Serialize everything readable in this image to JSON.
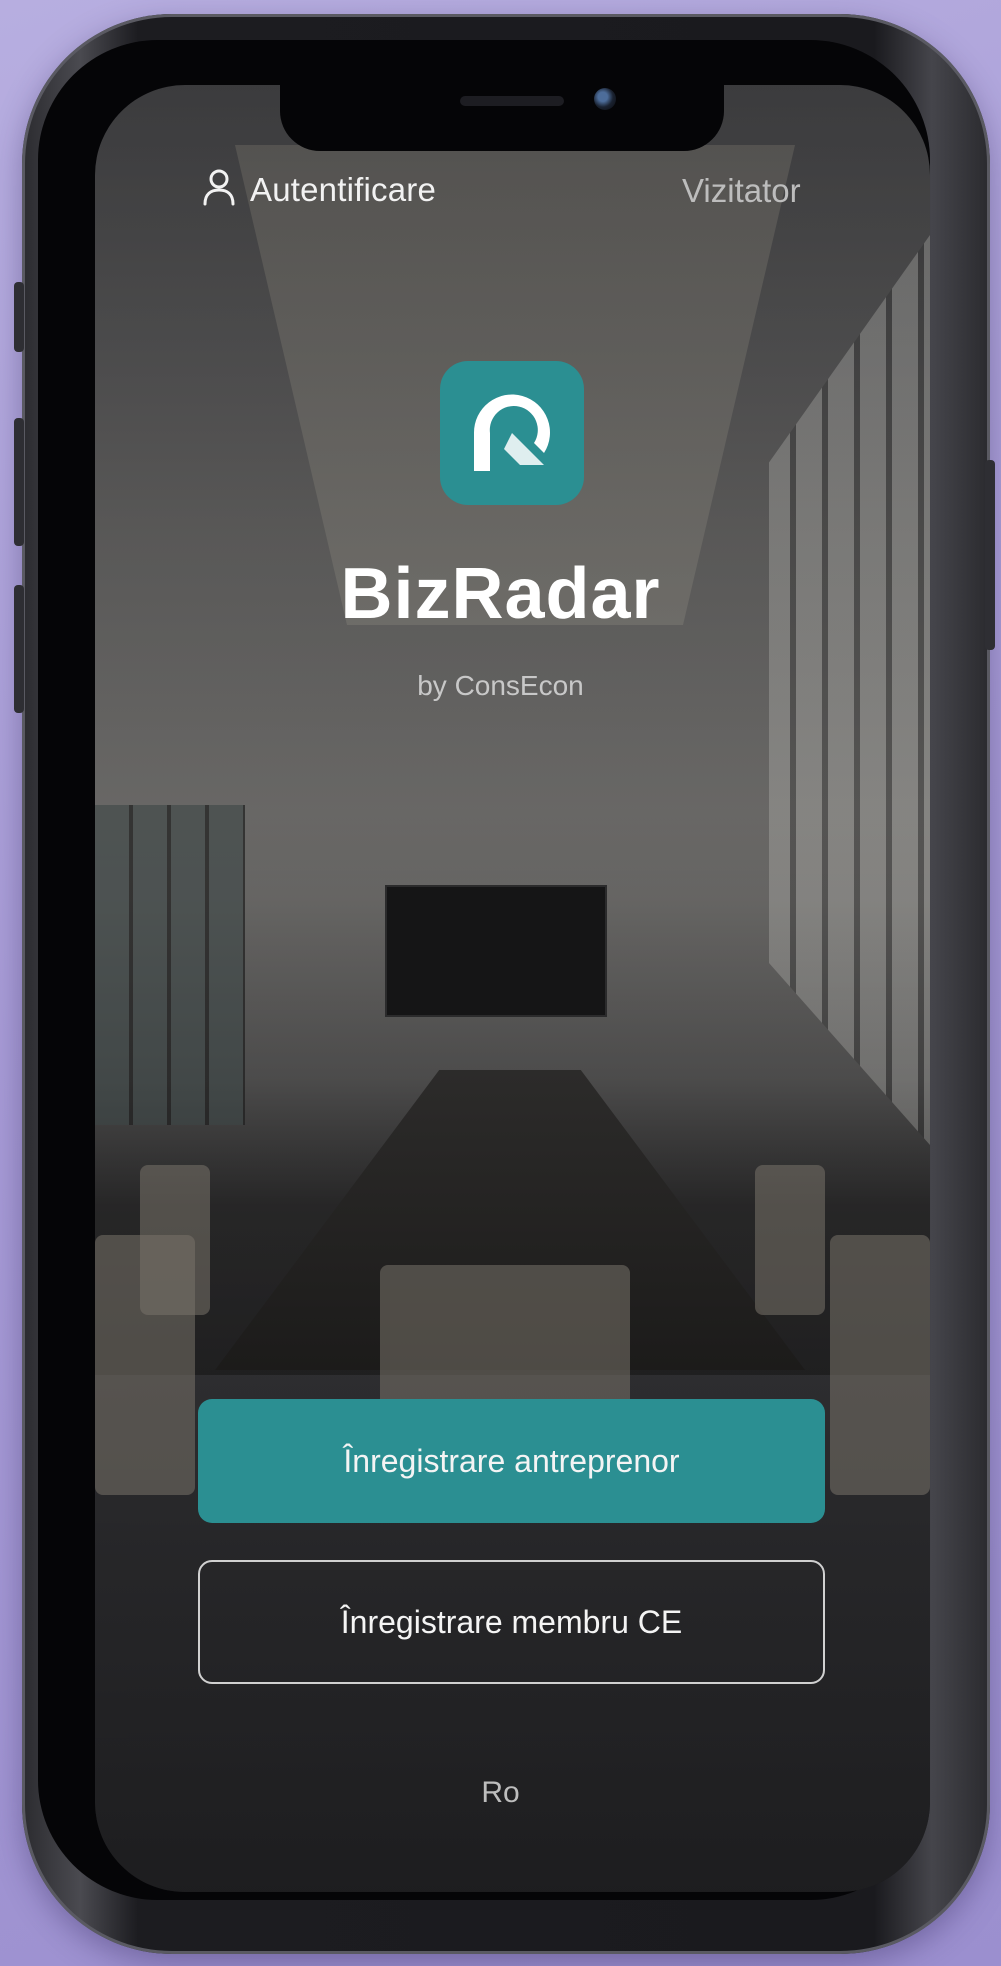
{
  "header": {
    "login_label": "Autentificare",
    "guest_label": "Vizitator"
  },
  "brand": {
    "name": "BizRadar",
    "byline": "by ConsEcon"
  },
  "actions": {
    "register_entrepreneur": "Înregistrare antreprenor",
    "register_member": "Înregistrare membru CE"
  },
  "footer": {
    "language": "Ro"
  },
  "colors": {
    "accent": "#2b8f92",
    "background_tint": "#a79bd6"
  },
  "icons": {
    "login": "user-icon",
    "logo": "bizradar-logo-icon"
  }
}
